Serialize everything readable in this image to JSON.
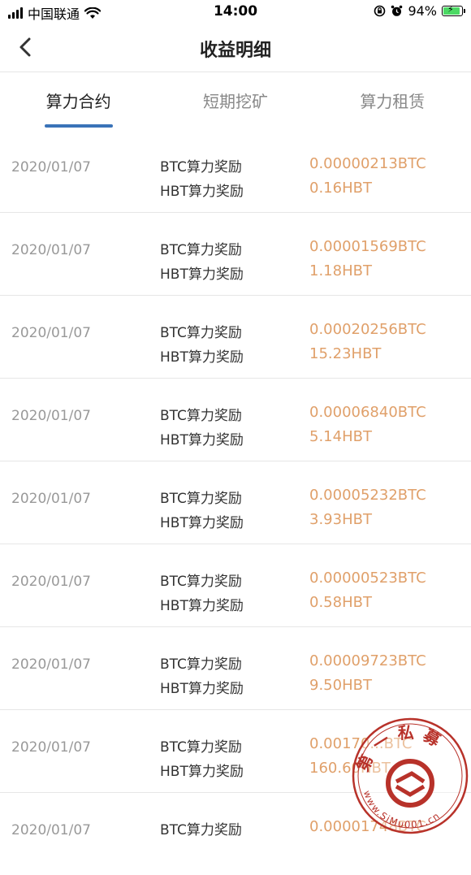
{
  "status_bar": {
    "carrier": "中国联通",
    "time": "14:00",
    "battery": "94%"
  },
  "header": {
    "title": "收益明细"
  },
  "tabs": [
    {
      "label": "算力合约",
      "active": true
    },
    {
      "label": "短期挖矿",
      "active": false
    },
    {
      "label": "算力租赁",
      "active": false
    }
  ],
  "records": [
    {
      "date": "2020/01/07",
      "btc_label": "BTC算力奖励",
      "btc_value": "0.00000213BTC",
      "hbt_label": "HBT算力奖励",
      "hbt_value": "0.16HBT"
    },
    {
      "date": "2020/01/07",
      "btc_label": "BTC算力奖励",
      "btc_value": "0.00001569BTC",
      "hbt_label": "HBT算力奖励",
      "hbt_value": "1.18HBT"
    },
    {
      "date": "2020/01/07",
      "btc_label": "BTC算力奖励",
      "btc_value": "0.00020256BTC",
      "hbt_label": "HBT算力奖励",
      "hbt_value": "15.23HBT"
    },
    {
      "date": "2020/01/07",
      "btc_label": "BTC算力奖励",
      "btc_value": "0.00006840BTC",
      "hbt_label": "HBT算力奖励",
      "hbt_value": "5.14HBT"
    },
    {
      "date": "2020/01/07",
      "btc_label": "BTC算力奖励",
      "btc_value": "0.00005232BTC",
      "hbt_label": "HBT算力奖励",
      "hbt_value": "3.93HBT"
    },
    {
      "date": "2020/01/07",
      "btc_label": "BTC算力奖励",
      "btc_value": "0.00000523BTC",
      "hbt_label": "HBT算力奖励",
      "hbt_value": "0.58HBT"
    },
    {
      "date": "2020/01/07",
      "btc_label": "BTC算力奖励",
      "btc_value": "0.00009723BTC",
      "hbt_label": "HBT算力奖励",
      "hbt_value": "9.50HBT"
    },
    {
      "date": "2020/01/07",
      "btc_label": "BTC算力奖励",
      "btc_value": "0.00170...BTC",
      "hbt_label": "HBT算力奖励",
      "hbt_value": "160.60HBT"
    },
    {
      "date": "2020/01/07",
      "btc_label": "BTC算力奖励",
      "btc_value": "0.00001748BTC",
      "hbt_label": "",
      "hbt_value": ""
    }
  ],
  "watermark": {
    "chars": [
      "第",
      "一",
      "私",
      "募"
    ],
    "url": "www.SiMu001.cn"
  },
  "colors": {
    "accent": "#3a73b8",
    "value": "#e0a06a",
    "seal": "#b8322a"
  },
  "icons": {
    "back": "chevron-left-icon",
    "signal": "signal-icon",
    "wifi": "wifi-icon",
    "lock": "orientation-lock-icon",
    "alarm": "alarm-icon",
    "battery": "battery-icon"
  }
}
